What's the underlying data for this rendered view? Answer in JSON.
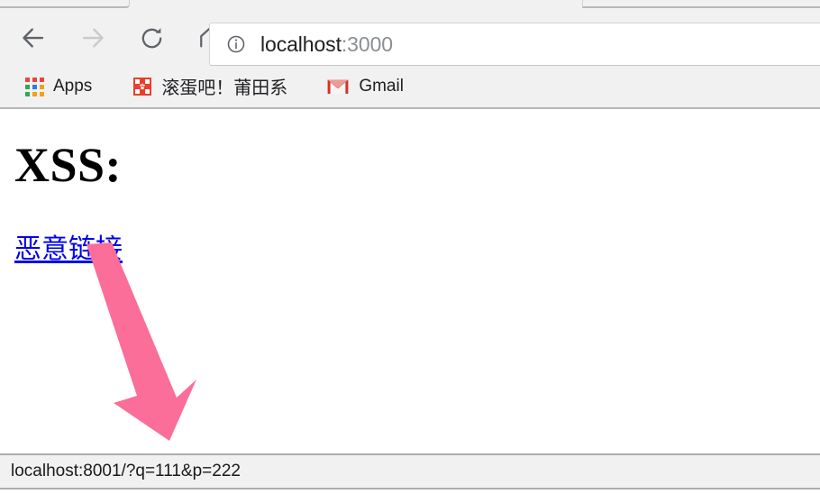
{
  "browser": {
    "nav": {
      "back_label": "Back",
      "back_icon": "arrow-left-icon",
      "forward_label": "Forward",
      "forward_icon": "arrow-right-icon",
      "reload_label": "Reload",
      "reload_icon": "reload-icon",
      "home_label": "Home",
      "home_icon": "home-icon"
    },
    "omnibox": {
      "security_icon": "info-circle-icon",
      "host": "localhost",
      "port": ":3000",
      "full_url": "localhost:3000"
    },
    "bookmarks": [
      {
        "label": "Apps",
        "icon": "apps-grid-icon"
      },
      {
        "label": "滚蛋吧！莆田系",
        "icon": "red-cross-paw-icon"
      },
      {
        "label": "Gmail",
        "icon": "gmail-icon"
      }
    ],
    "status_bar": {
      "text": "localhost:8001/?q=111&p=222"
    }
  },
  "page": {
    "title": "XSS:",
    "link_text": "恶意链接",
    "annotation": {
      "type": "arrow",
      "direction": "down",
      "color": "#fa6e99"
    }
  },
  "colors": {
    "chrome_bg": "#f1f1f1",
    "omnibox_bg": "#ffffff",
    "link_blue": "#0000ee",
    "arrow_pink": "#fa6e99",
    "apps_red": "#e8453c",
    "apps_green": "#31a853",
    "apps_blue": "#2b7de9",
    "apps_yellow": "#f0a022",
    "gmail_red": "#d93025",
    "status_bg": "#f1f1f1"
  }
}
